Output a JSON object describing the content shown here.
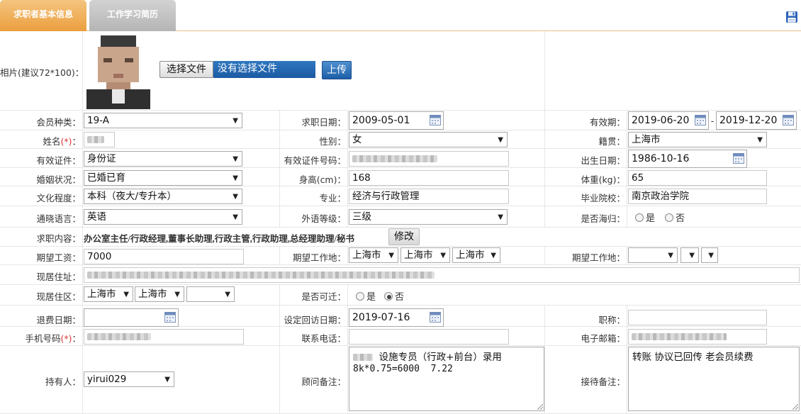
{
  "tabs": [
    {
      "label": "求职者基本信息",
      "active": true
    },
    {
      "label": "工作学习简历",
      "active": false
    }
  ],
  "photo": {
    "label": "相片(建议72*100)：",
    "choose_button": "选择文件",
    "file_status": "没有选择文件",
    "upload_button": "上传"
  },
  "row_member": {
    "member_type_label": "会员种类：",
    "member_type_value": "19-A",
    "job_date_label": "求职日期：",
    "job_date_value": "2009-05-01",
    "valid_label": "有效期：",
    "valid_start": "2019-06-20",
    "valid_sep": "-",
    "valid_end": "2019-12-20"
  },
  "row_name": {
    "name_label": "姓名",
    "name_req": "(*)",
    "name_colon": "：",
    "gender_label": "性别：",
    "gender_value": "女",
    "native_label": "籍贯：",
    "native_value": "上海市"
  },
  "row_id": {
    "id_type_label": "有效证件：",
    "id_type_value": "身份证",
    "id_no_label": "有效证件号码：",
    "birth_label": "出生日期：",
    "birth_value": "1986-10-16"
  },
  "row_marriage": {
    "marriage_label": "婚姻状况：",
    "marriage_value": "已婚已育",
    "height_label": "身高(cm)：",
    "height_value": "168",
    "weight_label": "体重(kg)：",
    "weight_value": "65"
  },
  "row_edu": {
    "edu_label": "文化程度：",
    "edu_value": "本科（夜大/专升本）",
    "major_label": "专业：",
    "major_value": "经济与行政管理",
    "school_label": "毕业院校：",
    "school_value": "南京政治学院"
  },
  "row_lang": {
    "lang_label": "通晓语言：",
    "lang_value": "英语",
    "level_label": "外语等级：",
    "level_value": "三级",
    "abroad_label": "是否海归：",
    "abroad_yes": "是",
    "abroad_no": "否"
  },
  "row_job": {
    "content_label": "求职内容：",
    "content_value": "办公室主任/行政经理,董事长助理,行政主管,行政助理,总经理助理/秘书",
    "modify_button": "修改"
  },
  "row_salary": {
    "salary_label": "期望工资：",
    "salary_value": "7000",
    "place1_label": "期望工作地：",
    "place1_a": "上海市",
    "place1_b": "上海市",
    "place1_c": "上海市",
    "place2_label": "期望工作地："
  },
  "row_address": {
    "address_label": "现居住址："
  },
  "row_district": {
    "district_label": "现居住区：",
    "district_a": "上海市",
    "district_b": "上海市",
    "relocate_label": "是否可迁：",
    "relocate_yes": "是",
    "relocate_no": "否"
  },
  "row_refund": {
    "refund_label": "退费日期：",
    "visit_label": "设定回访日期：",
    "visit_value": "2019-07-16",
    "title_label": "职称："
  },
  "row_phone": {
    "mobile_label": "手机号码",
    "mobile_req": "(*)",
    "mobile_colon": "：",
    "tel_label": "联系电话：",
    "email_label": "电子邮箱："
  },
  "row_holder": {
    "holder_label": "持有人：",
    "holder_value": "yirui029",
    "advisor_label": "顾问备注：",
    "advisor_note_line1": "设施专员（行政+前台）录用",
    "advisor_note_line2": "8k*0.75=6000  7.22",
    "reception_label": "接待备注：",
    "reception_note": "转账 协议已回传 老会员续费"
  }
}
